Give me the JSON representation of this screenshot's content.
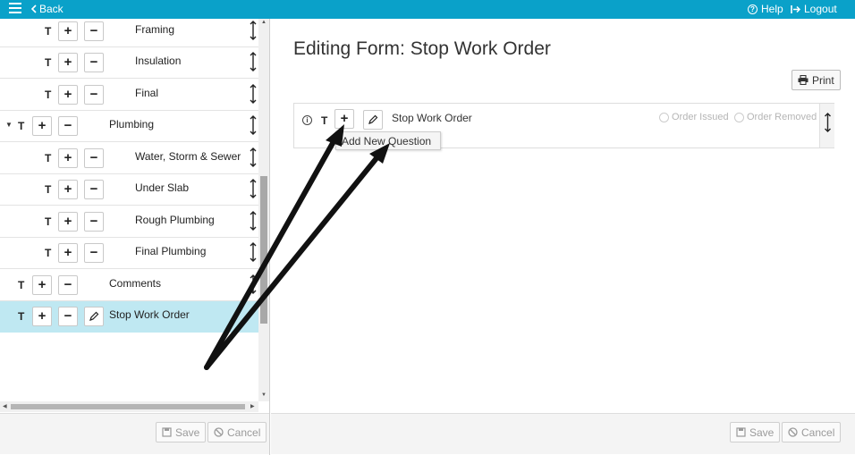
{
  "topbar": {
    "back_label": "Back",
    "help_label": "Help",
    "logout_label": "Logout",
    "color": "#0aa1c9"
  },
  "tree": {
    "rows": [
      {
        "label": "Framing"
      },
      {
        "label": "Insulation"
      },
      {
        "label": "Final"
      },
      {
        "label": "Plumbing"
      },
      {
        "label": "Water, Storm & Sewer"
      },
      {
        "label": "Under Slab"
      },
      {
        "label": "Rough Plumbing"
      },
      {
        "label": "Final Plumbing"
      },
      {
        "label": "Comments"
      },
      {
        "label": "Stop Work Order"
      }
    ],
    "type_char": "T",
    "add_symbol": "+",
    "remove_symbol": "−",
    "selected_color": "#bfe8f2"
  },
  "left_footer": {
    "save_label": "Save",
    "cancel_label": "Cancel"
  },
  "editor": {
    "title": "Editing Form: Stop Work Order",
    "print_label": "Print",
    "question": {
      "type_char": "T",
      "add_symbol": "+",
      "text": "Stop Work Order",
      "option_1": "Order Issued",
      "option_2": "Order Removed"
    },
    "popup_label": "Add New Question"
  },
  "right_footer": {
    "save_label": "Save",
    "cancel_label": "Cancel"
  }
}
